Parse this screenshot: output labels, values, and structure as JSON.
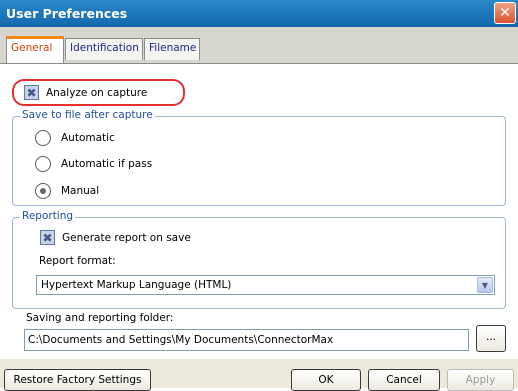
{
  "window": {
    "title": "User Preferences",
    "close_glyph": "✕"
  },
  "tabs": [
    {
      "label": "General",
      "active": true
    },
    {
      "label": "Identification",
      "active": false
    },
    {
      "label": "Filename",
      "active": false
    }
  ],
  "general": {
    "analyze_on_capture": {
      "label": "Analyze on capture",
      "checked": true
    },
    "save_group": {
      "legend": "Save to file after capture",
      "options": [
        {
          "label": "Automatic",
          "selected": false
        },
        {
          "label": "Automatic if pass",
          "selected": false
        },
        {
          "label": "Manual",
          "selected": true
        }
      ]
    },
    "reporting_group": {
      "legend": "Reporting",
      "generate_report": {
        "label": "Generate report on save",
        "checked": true
      },
      "report_format_label": "Report format:",
      "report_format_value": "Hypertext Markup Language (HTML)"
    },
    "folder": {
      "label": "Saving and reporting folder:",
      "value": "C:\\Documents and Settings\\My Documents\\ConnectorMax",
      "browse_label": "..."
    }
  },
  "buttons": {
    "restore": "Restore Factory Settings",
    "ok": "OK",
    "cancel": "Cancel",
    "apply": "Apply"
  },
  "colors": {
    "title_bar": "#1468ad",
    "active_tab_accent": "#f08a16",
    "highlight": "#e53030"
  }
}
